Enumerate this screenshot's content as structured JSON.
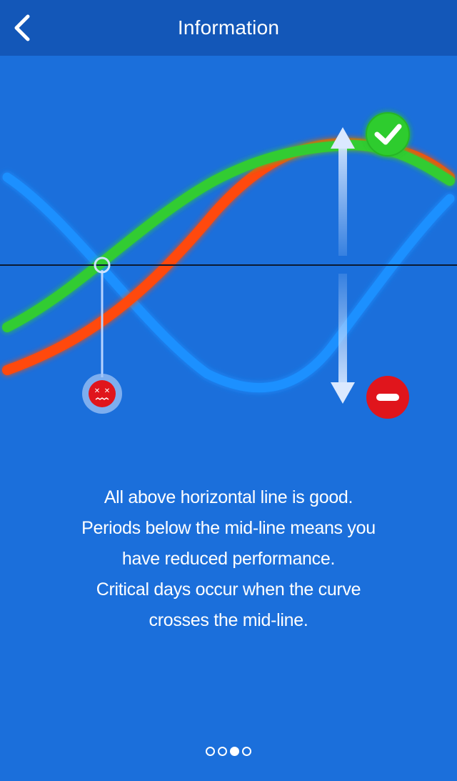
{
  "header": {
    "title": "Information",
    "back_icon": "chevron-left-icon"
  },
  "illustration": {
    "curves": [
      {
        "name": "green-curve",
        "color": "#33cc33"
      },
      {
        "name": "red-curve",
        "color": "#ff4a0a"
      },
      {
        "name": "blue-curve",
        "color": "#1e90ff"
      }
    ],
    "good_icon": "check-circle-icon",
    "good_color": "#2ecc2e",
    "bad_icon": "minus-circle-icon",
    "bad_color": "#e0151c",
    "critical_icon": "sad-face-icon",
    "critical_color": "#e0151c",
    "arrow_icon": "double-arrow-vertical-icon"
  },
  "info": {
    "lines": [
      "All above horizontal line is good.",
      "Periods below the mid-line means you",
      "have reduced performance.",
      "Critical days occur when the curve",
      "crosses the mid-line."
    ]
  },
  "pager": {
    "total": 4,
    "active_index": 2
  }
}
